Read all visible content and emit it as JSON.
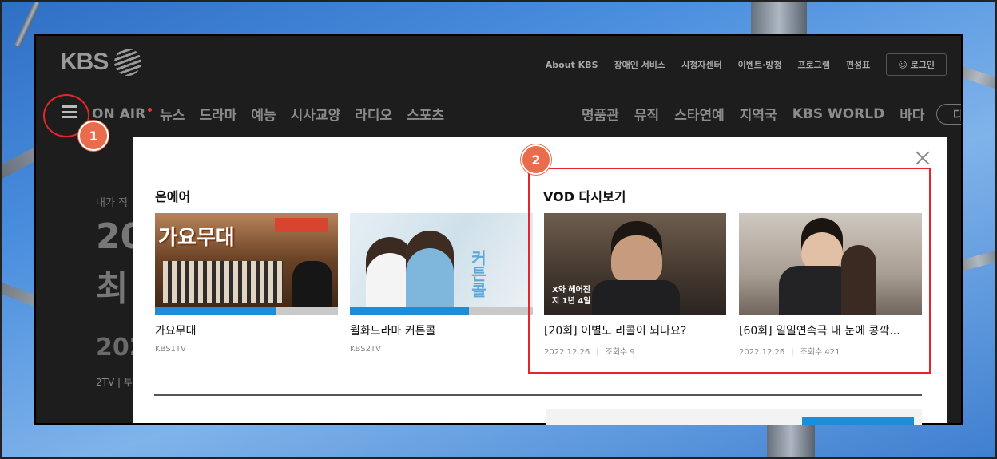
{
  "header": {
    "logo_text": "KBS",
    "util_links": [
      "About KBS",
      "장애인 서비스",
      "시청자센터",
      "이벤트·방청",
      "프로그램",
      "편성표"
    ],
    "login_label": "로그인"
  },
  "main_nav": {
    "onair_label": "ON AIR",
    "items": [
      "뉴스",
      "드라마",
      "예능",
      "시사교양",
      "라디오",
      "스포츠"
    ],
    "right_items": [
      "명품관",
      "뮤직",
      "스타연예",
      "지역국",
      "KBS WORLD",
      "바다"
    ],
    "more_label": "다시"
  },
  "hero": {
    "small": "내가 직",
    "line1": "20",
    "line2": "최",
    "line3": "202",
    "meta": "2TV  |  투"
  },
  "panel": {
    "onair": {
      "title": "온에어",
      "cards": [
        {
          "title": "가요무대",
          "channel": "KBS1TV",
          "progress": 0.66,
          "thumb_caption": "가요무대"
        },
        {
          "title": "월화드라마 커튼콜",
          "channel": "KBS2TV",
          "progress": 0.65,
          "thumb_caption": "커튼콜"
        }
      ]
    },
    "vod": {
      "title": "VOD 다시보기",
      "cards": [
        {
          "title": "[20회] 이별도 리콜이 되나요?",
          "date": "2022.12.26",
          "views": "조회수 9",
          "thumb_caption": "X와 헤어진 지 1년 4일"
        },
        {
          "title": "[60회] 일일연속극 내 눈에 콩깍...",
          "date": "2022.12.26",
          "views": "조회수 421"
        }
      ]
    }
  },
  "annotations": {
    "badge1": "1",
    "badge2": "2"
  },
  "colors": {
    "accent_blue": "#1a8ddb",
    "highlight_red": "#e4262c",
    "badge_orange": "#e96d4c"
  }
}
